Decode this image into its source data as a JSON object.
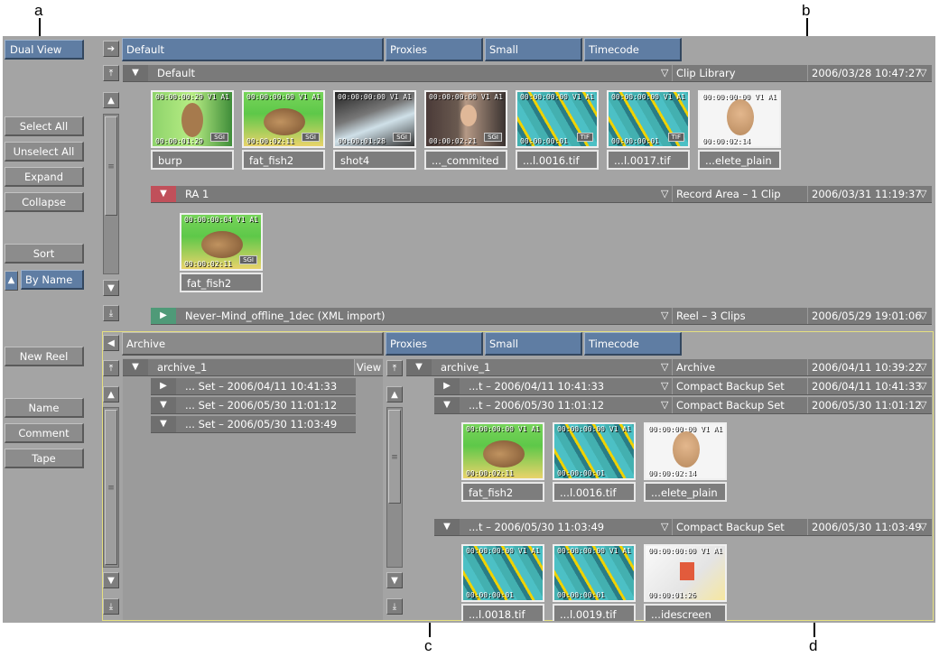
{
  "callouts": {
    "a": "a",
    "b": "b",
    "c": "c",
    "d": "d"
  },
  "left_panel": {
    "dual_view": "Dual View",
    "select_all": "Select All",
    "unselect_all": "Unselect All",
    "expand": "Expand",
    "collapse": "Collapse",
    "sort": "Sort",
    "by_name": "By Name",
    "new_reel": "New Reel",
    "name": "Name",
    "comment": "Comment",
    "tape": "Tape"
  },
  "top": {
    "tabs": [
      "Default",
      "Proxies",
      "Small",
      "Timecode"
    ],
    "library_row": {
      "name": "Default",
      "type": "Clip Library",
      "date": "2006/03/28 10:47:27"
    },
    "clips": [
      {
        "tc_in": "00:00:00:29",
        "tc_out": "00:00:01:29",
        "vt": "V1 A1",
        "badge": "SGI",
        "name": "burp"
      },
      {
        "tc_in": "00:00:00:00",
        "tc_out": "00:00:02:11",
        "vt": "V1 A1",
        "badge": "SGI",
        "name": "fat_fish2"
      },
      {
        "tc_in": "00:00:00:00",
        "tc_out": "00:00:01:28",
        "vt": "V1 A1",
        "badge": "SGI",
        "name": "shot4"
      },
      {
        "tc_in": "00:00:00:00",
        "tc_out": "00:00:02:21",
        "vt": "V1 A1",
        "badge": "SGI",
        "name": "..._commited"
      },
      {
        "tc_in": "00:00:00:00",
        "tc_out": "00:00:00:01",
        "vt": "V1 A1",
        "badge": "TIF",
        "name": "...l.0016.tif"
      },
      {
        "tc_in": "00:00:00:00",
        "tc_out": "00:00:00:01",
        "vt": "V1 A1",
        "badge": "TIF",
        "name": "...l.0017.tif"
      },
      {
        "tc_in": "00:00:00:00",
        "tc_out": "00:00:02:14",
        "vt": "V1 A1",
        "badge": "",
        "name": "...elete_plain"
      }
    ],
    "ra_row": {
      "name": "RA 1",
      "type": "Record Area – 1 Clip",
      "date": "2006/03/31 11:19:37"
    },
    "ra_clip": {
      "tc_in": "00:00:00:04",
      "tc_out": "00:00:02:11",
      "vt": "V1 A1",
      "badge": "SGI",
      "name": "fat_fish2"
    },
    "reel_row": {
      "name": "Never–Mind_offline_1dec (XML import)",
      "type": "Reel – 3 Clips",
      "date": "2006/05/29 19:01:06"
    }
  },
  "bottom": {
    "archive_tab": "Archive",
    "tabs": [
      "Proxies",
      "Small",
      "Timecode"
    ],
    "left_tree": {
      "root": "archive_1",
      "view": "View",
      "sets": [
        "... Set –  2006/04/11 10:41:33",
        "... Set –  2006/05/30 11:01:12",
        "... Set –  2006/05/30 11:03:49"
      ]
    },
    "right_root": {
      "name": "archive_1",
      "type": "Archive",
      "date": "2006/04/11 10:39:22"
    },
    "set_rows": [
      {
        "name": "...t –  2006/04/11 10:41:33",
        "type": "Compact Backup Set",
        "date": "2006/04/11 10:41:33"
      },
      {
        "name": "...t –  2006/05/30 11:01:12",
        "type": "Compact Backup Set",
        "date": "2006/05/30 11:01:12"
      },
      {
        "name": "...t –  2006/05/30 11:03:49",
        "type": "Compact Backup Set",
        "date": "2006/05/30 11:03:49"
      }
    ],
    "set2_clips": [
      {
        "tc_in": "00:00:00:00",
        "tc_out": "00:00:02:11",
        "vt": "V1 A1",
        "badge": "",
        "name": "fat_fish2"
      },
      {
        "tc_in": "00:00:00:00",
        "tc_out": "00:00:00:01",
        "vt": "V1 A1",
        "badge": "",
        "name": "...l.0016.tif"
      },
      {
        "tc_in": "00:00:00:00",
        "tc_out": "00:00:02:14",
        "vt": "V1 A1",
        "badge": "",
        "name": "...elete_plain"
      }
    ],
    "set3_clips": [
      {
        "tc_in": "00:00:00:00",
        "tc_out": "00:00:00:01",
        "vt": "V1 A1",
        "badge": "",
        "name": "...l.0018.tif"
      },
      {
        "tc_in": "00:00:00:00",
        "tc_out": "00:00:00:01",
        "vt": "V1 A1",
        "badge": "",
        "name": "...l.0019.tif"
      },
      {
        "tc_in": "00:00:00:00",
        "tc_out": "00:00:01:26",
        "vt": "V1 A1",
        "badge": "",
        "name": "...idescreen"
      }
    ]
  }
}
